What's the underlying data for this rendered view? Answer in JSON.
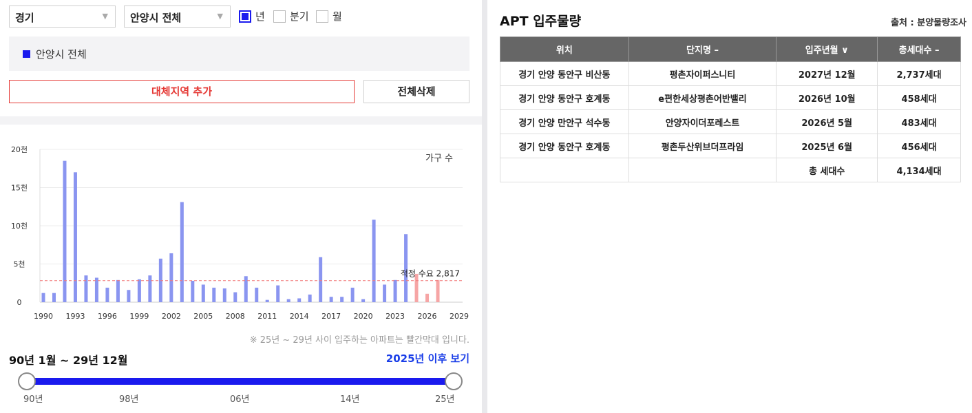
{
  "filters": {
    "province": "경기",
    "city": "안양시 전체",
    "period_options": [
      {
        "label": "년",
        "checked": true
      },
      {
        "label": "분기",
        "checked": false
      },
      {
        "label": "월",
        "checked": false
      }
    ]
  },
  "selected_region": "안양시 전체",
  "buttons": {
    "add_region": "대체지역 추가",
    "delete_all": "전체삭제"
  },
  "chart_data": {
    "type": "bar",
    "legend": "가구 수",
    "y_ticks": [
      "0",
      "5천",
      "10천",
      "15천",
      "20천"
    ],
    "x_ticks": [
      "1990",
      "1993",
      "1996",
      "1999",
      "2002",
      "2005",
      "2008",
      "2011",
      "2014",
      "2017",
      "2020",
      "2023",
      "2026",
      "2029"
    ],
    "x": [
      1990,
      1991,
      1992,
      1993,
      1994,
      1995,
      1996,
      1997,
      1998,
      1999,
      2000,
      2001,
      2002,
      2003,
      2004,
      2005,
      2006,
      2007,
      2008,
      2009,
      2010,
      2011,
      2012,
      2013,
      2014,
      2015,
      2016,
      2017,
      2018,
      2019,
      2020,
      2021,
      2022,
      2023,
      2024,
      2025,
      2026,
      2027
    ],
    "values": [
      1200,
      1200,
      18500,
      17000,
      3500,
      3200,
      1900,
      2900,
      1600,
      3000,
      3500,
      5700,
      6400,
      13100,
      2800,
      2300,
      1900,
      1800,
      1300,
      3400,
      1900,
      300,
      2200,
      400,
      500,
      1000,
      5900,
      700,
      700,
      1900,
      400,
      10800,
      2300,
      2900,
      8900,
      3700,
      1100,
      2900
    ],
    "highlight_from": 2025,
    "colors": {
      "normal": "#8a95f0",
      "future": "#f6a5a5",
      "reference": "#f27a7a"
    },
    "reference_label": "적정 수요 2,817",
    "reference_value": 2817,
    "ylim": [
      0,
      20000
    ],
    "xlim": [
      1990,
      2029
    ]
  },
  "footnote": "※ 25년 ~ 29년 사이 입주하는 아파트는 빨간막대 입니다.",
  "range": {
    "label": "90년 1월 ~ 29년 12월",
    "after_link": "2025년 이후 보기",
    "ticks": [
      "90년",
      "98년",
      "06년",
      "14년",
      "25년"
    ]
  },
  "table": {
    "title": "APT 입주물량",
    "source": "출처 : 분양물량조사",
    "headers": [
      "위치",
      "단지명 –",
      "입주년월 ∨",
      "총세대수 –"
    ],
    "rows": [
      [
        "경기 안양 동안구 비산동",
        "평촌자이퍼스니티",
        "2027년 12월",
        "2,737세대"
      ],
      [
        "경기 안양 동안구 호계동",
        "e편한세상평촌어반밸리",
        "2026년 10월",
        "458세대"
      ],
      [
        "경기 안양 만안구 석수동",
        "안양자이더포레스트",
        "2026년 5월",
        "483세대"
      ],
      [
        "경기 안양 동안구 호계동",
        "평촌두산위브더프라임",
        "2025년 6월",
        "456세대"
      ]
    ],
    "total_label": "총 세대수",
    "total_value": "4,134세대"
  }
}
